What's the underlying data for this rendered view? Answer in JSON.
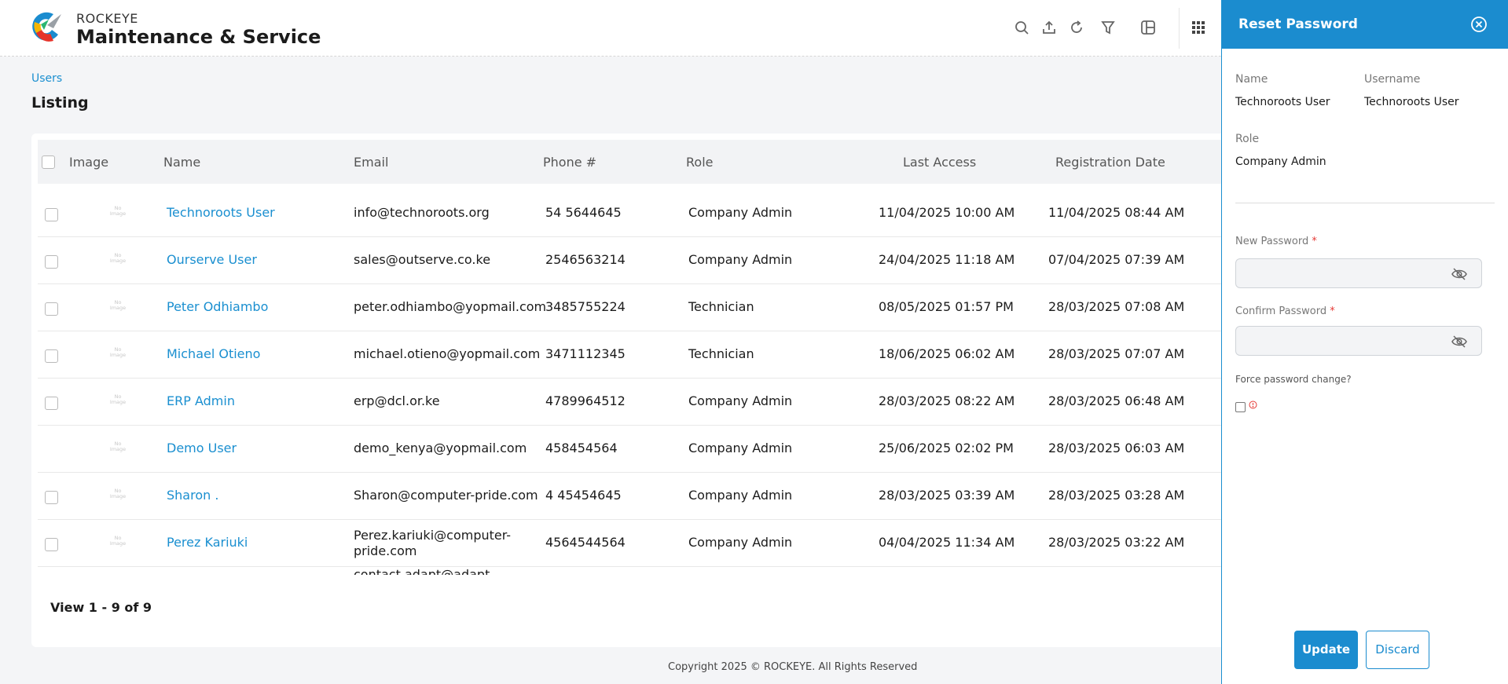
{
  "header": {
    "brand_small": "ROCKEYE",
    "brand_big": "Maintenance & Service",
    "icons": [
      "search-icon",
      "upload-icon",
      "refresh-icon",
      "filter-icon",
      "columns-icon",
      "apps-grid-icon"
    ]
  },
  "breadcrumb": "Users",
  "page_title": "Listing",
  "table": {
    "headers": [
      "Image",
      "Name",
      "Email",
      "Phone #",
      "Role",
      "Last Access",
      "Registration Date"
    ],
    "no_image_text": "No Image",
    "rows": [
      {
        "name": "Technoroots User",
        "email": "info@technoroots.org",
        "email2": "",
        "phone": "54 5644645",
        "role": "Company Admin",
        "last_access": "11/04/2025 10:00 AM",
        "registered": "11/04/2025 08:44 AM",
        "checkbox": true
      },
      {
        "name": "Ourserve User",
        "email": "sales@outserve.co.ke",
        "email2": "",
        "phone": "2546563214",
        "role": "Company Admin",
        "last_access": "24/04/2025 11:18 AM",
        "registered": "07/04/2025 07:39 AM",
        "checkbox": true
      },
      {
        "name": "Peter Odhiambo",
        "email": "peter.odhiambo@yopmail.com",
        "email2": "",
        "phone": "3485755224",
        "role": "Technician",
        "last_access": "08/05/2025 01:57 PM",
        "registered": "28/03/2025 07:08 AM",
        "checkbox": true
      },
      {
        "name": "Michael Otieno",
        "email": "michael.otieno@yopmail.com",
        "email2": "",
        "phone": "3471112345",
        "role": "Technician",
        "last_access": "18/06/2025 06:02 AM",
        "registered": "28/03/2025 07:07 AM",
        "checkbox": true
      },
      {
        "name": "ERP Admin",
        "email": "erp@dcl.or.ke",
        "email2": "",
        "phone": "4789964512",
        "role": "Company Admin",
        "last_access": "28/03/2025 08:22 AM",
        "registered": "28/03/2025 06:48 AM",
        "checkbox": true
      },
      {
        "name": "Demo User",
        "email": "demo_kenya@yopmail.com",
        "email2": "",
        "phone": "458454564",
        "role": "Company Admin",
        "last_access": "25/06/2025 02:02 PM",
        "registered": "28/03/2025 06:03 AM",
        "checkbox": false
      },
      {
        "name": "Sharon .",
        "email": "Sharon@computer-pride.com",
        "email2": "",
        "phone": "4 45454645",
        "role": "Company Admin",
        "last_access": "28/03/2025 03:39 AM",
        "registered": "28/03/2025 03:28 AM",
        "checkbox": true
      },
      {
        "name": "Perez Kariuki",
        "email": "Perez.kariuki@computer-",
        "email2": "pride.com",
        "phone": "4564544564",
        "role": "Company Admin",
        "last_access": "04/04/2025 11:34 AM",
        "registered": "28/03/2025 03:22 AM",
        "checkbox": true
      },
      {
        "name": "",
        "email": "contact.adapt@adapt",
        "email2": "",
        "phone": "",
        "role": "",
        "last_access": "",
        "registered": "",
        "checkbox": false
      }
    ]
  },
  "pager_text": "View 1 - 9 of 9",
  "footer": "Copyright 2025 © ROCKEYE. All Rights Reserved",
  "panel": {
    "title": "Reset Password",
    "name_label": "Name",
    "name_value": "Technoroots User",
    "username_label": "Username",
    "username_value": "Technoroots User",
    "role_label": "Role",
    "role_value": "Company Admin",
    "new_password_label": "New Password",
    "confirm_password_label": "Confirm Password",
    "required_mark": "*",
    "force_label": "Force password change?",
    "update_label": "Update",
    "discard_label": "Discard"
  },
  "colors": {
    "accent": "#1b8ccf",
    "link": "#1a8fd0",
    "background": "#f4f5f7"
  }
}
